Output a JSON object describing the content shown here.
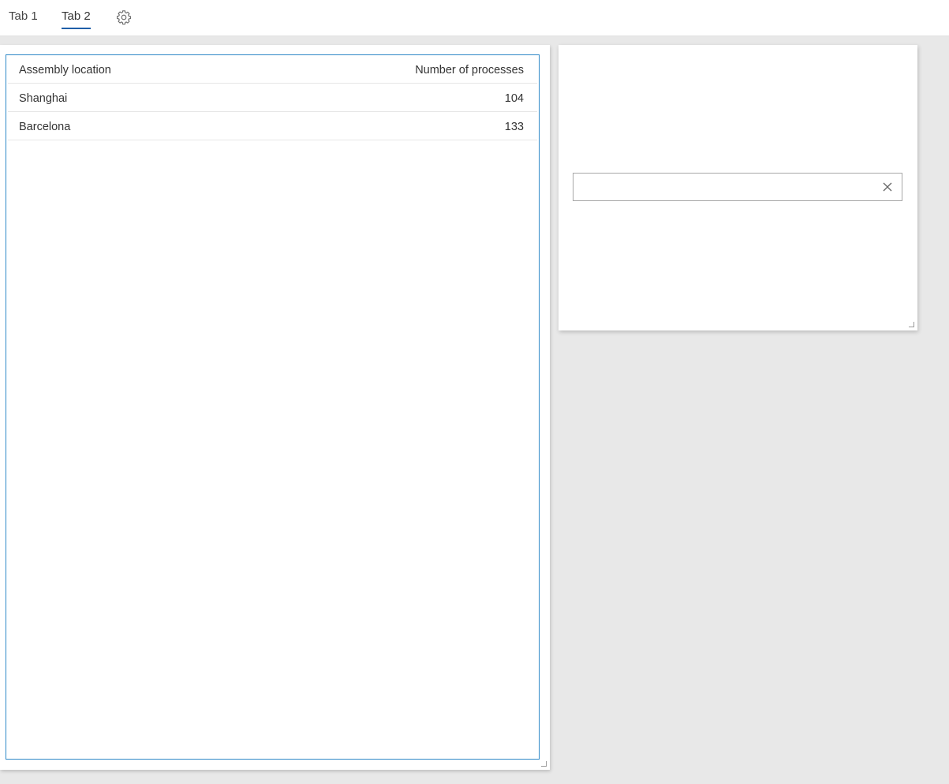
{
  "tabs": [
    {
      "label": "Tab 1",
      "active": false
    },
    {
      "label": "Tab 2",
      "active": true
    }
  ],
  "settings_icon": "gear-icon",
  "table": {
    "columns": [
      "Assembly location",
      "Number of processes"
    ],
    "rows": [
      [
        "Shanghai",
        "104"
      ],
      [
        "Barcelona",
        "133"
      ]
    ]
  },
  "filter": {
    "value": "",
    "placeholder": "",
    "clear_icon": "close-icon"
  },
  "colors": {
    "accent": "#1f5fa8",
    "table_border": "#2e88c7",
    "background": "#e8e8e8"
  }
}
